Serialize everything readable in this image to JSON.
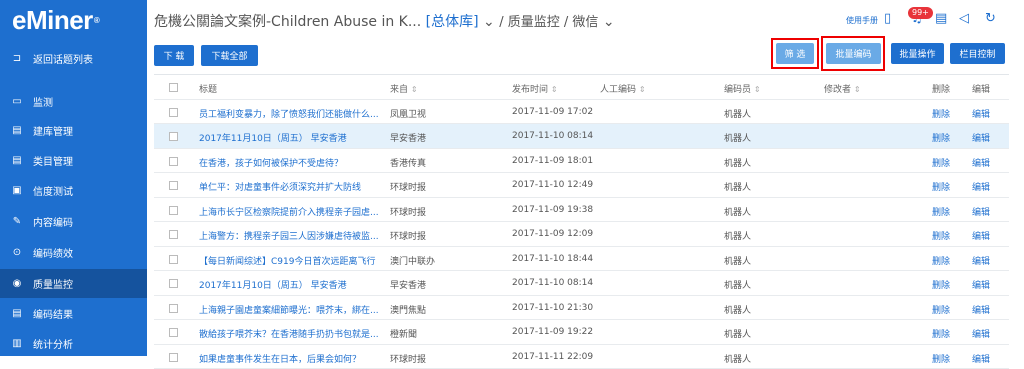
{
  "sidebar": {
    "logo": "eMiner",
    "logo_mark": "®",
    "items": [
      {
        "label": "返回话题列表",
        "icon": "back-icon",
        "glyph": "⊐"
      },
      {
        "label": "监测",
        "icon": "monitor-icon",
        "glyph": "▭"
      },
      {
        "label": "建库管理",
        "icon": "document-icon",
        "glyph": "▤"
      },
      {
        "label": "类目管理",
        "icon": "document-icon",
        "glyph": "▤"
      },
      {
        "label": "信度测试",
        "icon": "test-icon",
        "glyph": "▣"
      },
      {
        "label": "内容编码",
        "icon": "pen-icon",
        "glyph": "✎"
      },
      {
        "label": "编码绩效",
        "icon": "target-icon",
        "glyph": "⊙"
      },
      {
        "label": "质量监控",
        "icon": "eye-icon",
        "glyph": "◉"
      },
      {
        "label": "编码结果",
        "icon": "list-icon",
        "glyph": "▤"
      },
      {
        "label": "统计分析",
        "icon": "chart-icon",
        "glyph": "▥"
      }
    ],
    "active": "质量监控"
  },
  "header": {
    "title": "危機公關論文案例-Children Abuse in K...",
    "db": "[总体库]",
    "path": "/ 质量监控 / 微信",
    "chev": "⌄",
    "manual": "使用手册",
    "badge": "99+",
    "icons": {
      "doc": "▯",
      "bell": "♫",
      "list": "▤",
      "send": "◁",
      "refresh": "↻"
    }
  },
  "toolbar": {
    "download": "下 载",
    "download_all": "下载全部",
    "filter": "筛 选",
    "batch_code": "批量编码",
    "batch_op": "批量操作",
    "columns": "栏目控制"
  },
  "table": {
    "headers": {
      "title": "标题",
      "source": "来自",
      "time": "发布时间",
      "manual": "人工编码",
      "coder": "编码员",
      "editor": "修改者",
      "delete": "删除",
      "edit": "编辑"
    },
    "sort": "⇕",
    "rows": [
      {
        "title": "员工福利变暴力，除了愤怒我们还能做什么...",
        "source": "凤凰卫视",
        "time": "2017-11-09 17:02",
        "coder": "机器人",
        "delete": "删除",
        "edit": "编辑"
      },
      {
        "title": "2017年11月10日（周五） 早安香港",
        "source": "早安香港",
        "time": "2017-11-10 08:14",
        "coder": "机器人",
        "delete": "删除",
        "edit": "编辑"
      },
      {
        "title": "在香港，孩子如何被保护不受虐待？",
        "source": "香港传真",
        "time": "2017-11-09 18:01",
        "coder": "机器人",
        "delete": "删除",
        "edit": "编辑"
      },
      {
        "title": "单仁平：对虐童事件必须深究并扩大防线",
        "source": "环球时报",
        "time": "2017-11-10 12:49",
        "coder": "机器人",
        "delete": "删除",
        "edit": "编辑"
      },
      {
        "title": "上海市长宁区检察院提前介入携程亲子园虐...",
        "source": "环球时报",
        "time": "2017-11-09 19:38",
        "coder": "机器人",
        "delete": "删除",
        "edit": "编辑"
      },
      {
        "title": "上海警方：携程亲子园三人因涉嫌虐待被监...",
        "source": "环球时报",
        "time": "2017-11-09 12:09",
        "coder": "机器人",
        "delete": "删除",
        "edit": "编辑"
      },
      {
        "title": "【每日新闻综述】C919今日首次远距离飞行",
        "source": "澳门中联办",
        "time": "2017-11-10 18:44",
        "coder": "机器人",
        "delete": "删除",
        "edit": "编辑"
      },
      {
        "title": "2017年11月10日（周五） 早安香港",
        "source": "早安香港",
        "time": "2017-11-10 08:14",
        "coder": "机器人",
        "delete": "删除",
        "edit": "编辑"
      },
      {
        "title": "上海親子園虐童案細節曝光：喂芥末，綁在...",
        "source": "澳門焦點",
        "time": "2017-11-10 21:30",
        "coder": "机器人",
        "delete": "删除",
        "edit": "编辑"
      },
      {
        "title": "散給孩子喂芥末？在香港随手扔扔书包就是...",
        "source": "橙新聞",
        "time": "2017-11-09 19:22",
        "coder": "机器人",
        "delete": "删除",
        "edit": "编辑"
      },
      {
        "title": "如果虐童事件发生在日本，后果会如何？",
        "source": "环球时报",
        "time": "2017-11-11 22:09",
        "coder": "机器人",
        "delete": "删除",
        "edit": "编辑"
      }
    ]
  }
}
